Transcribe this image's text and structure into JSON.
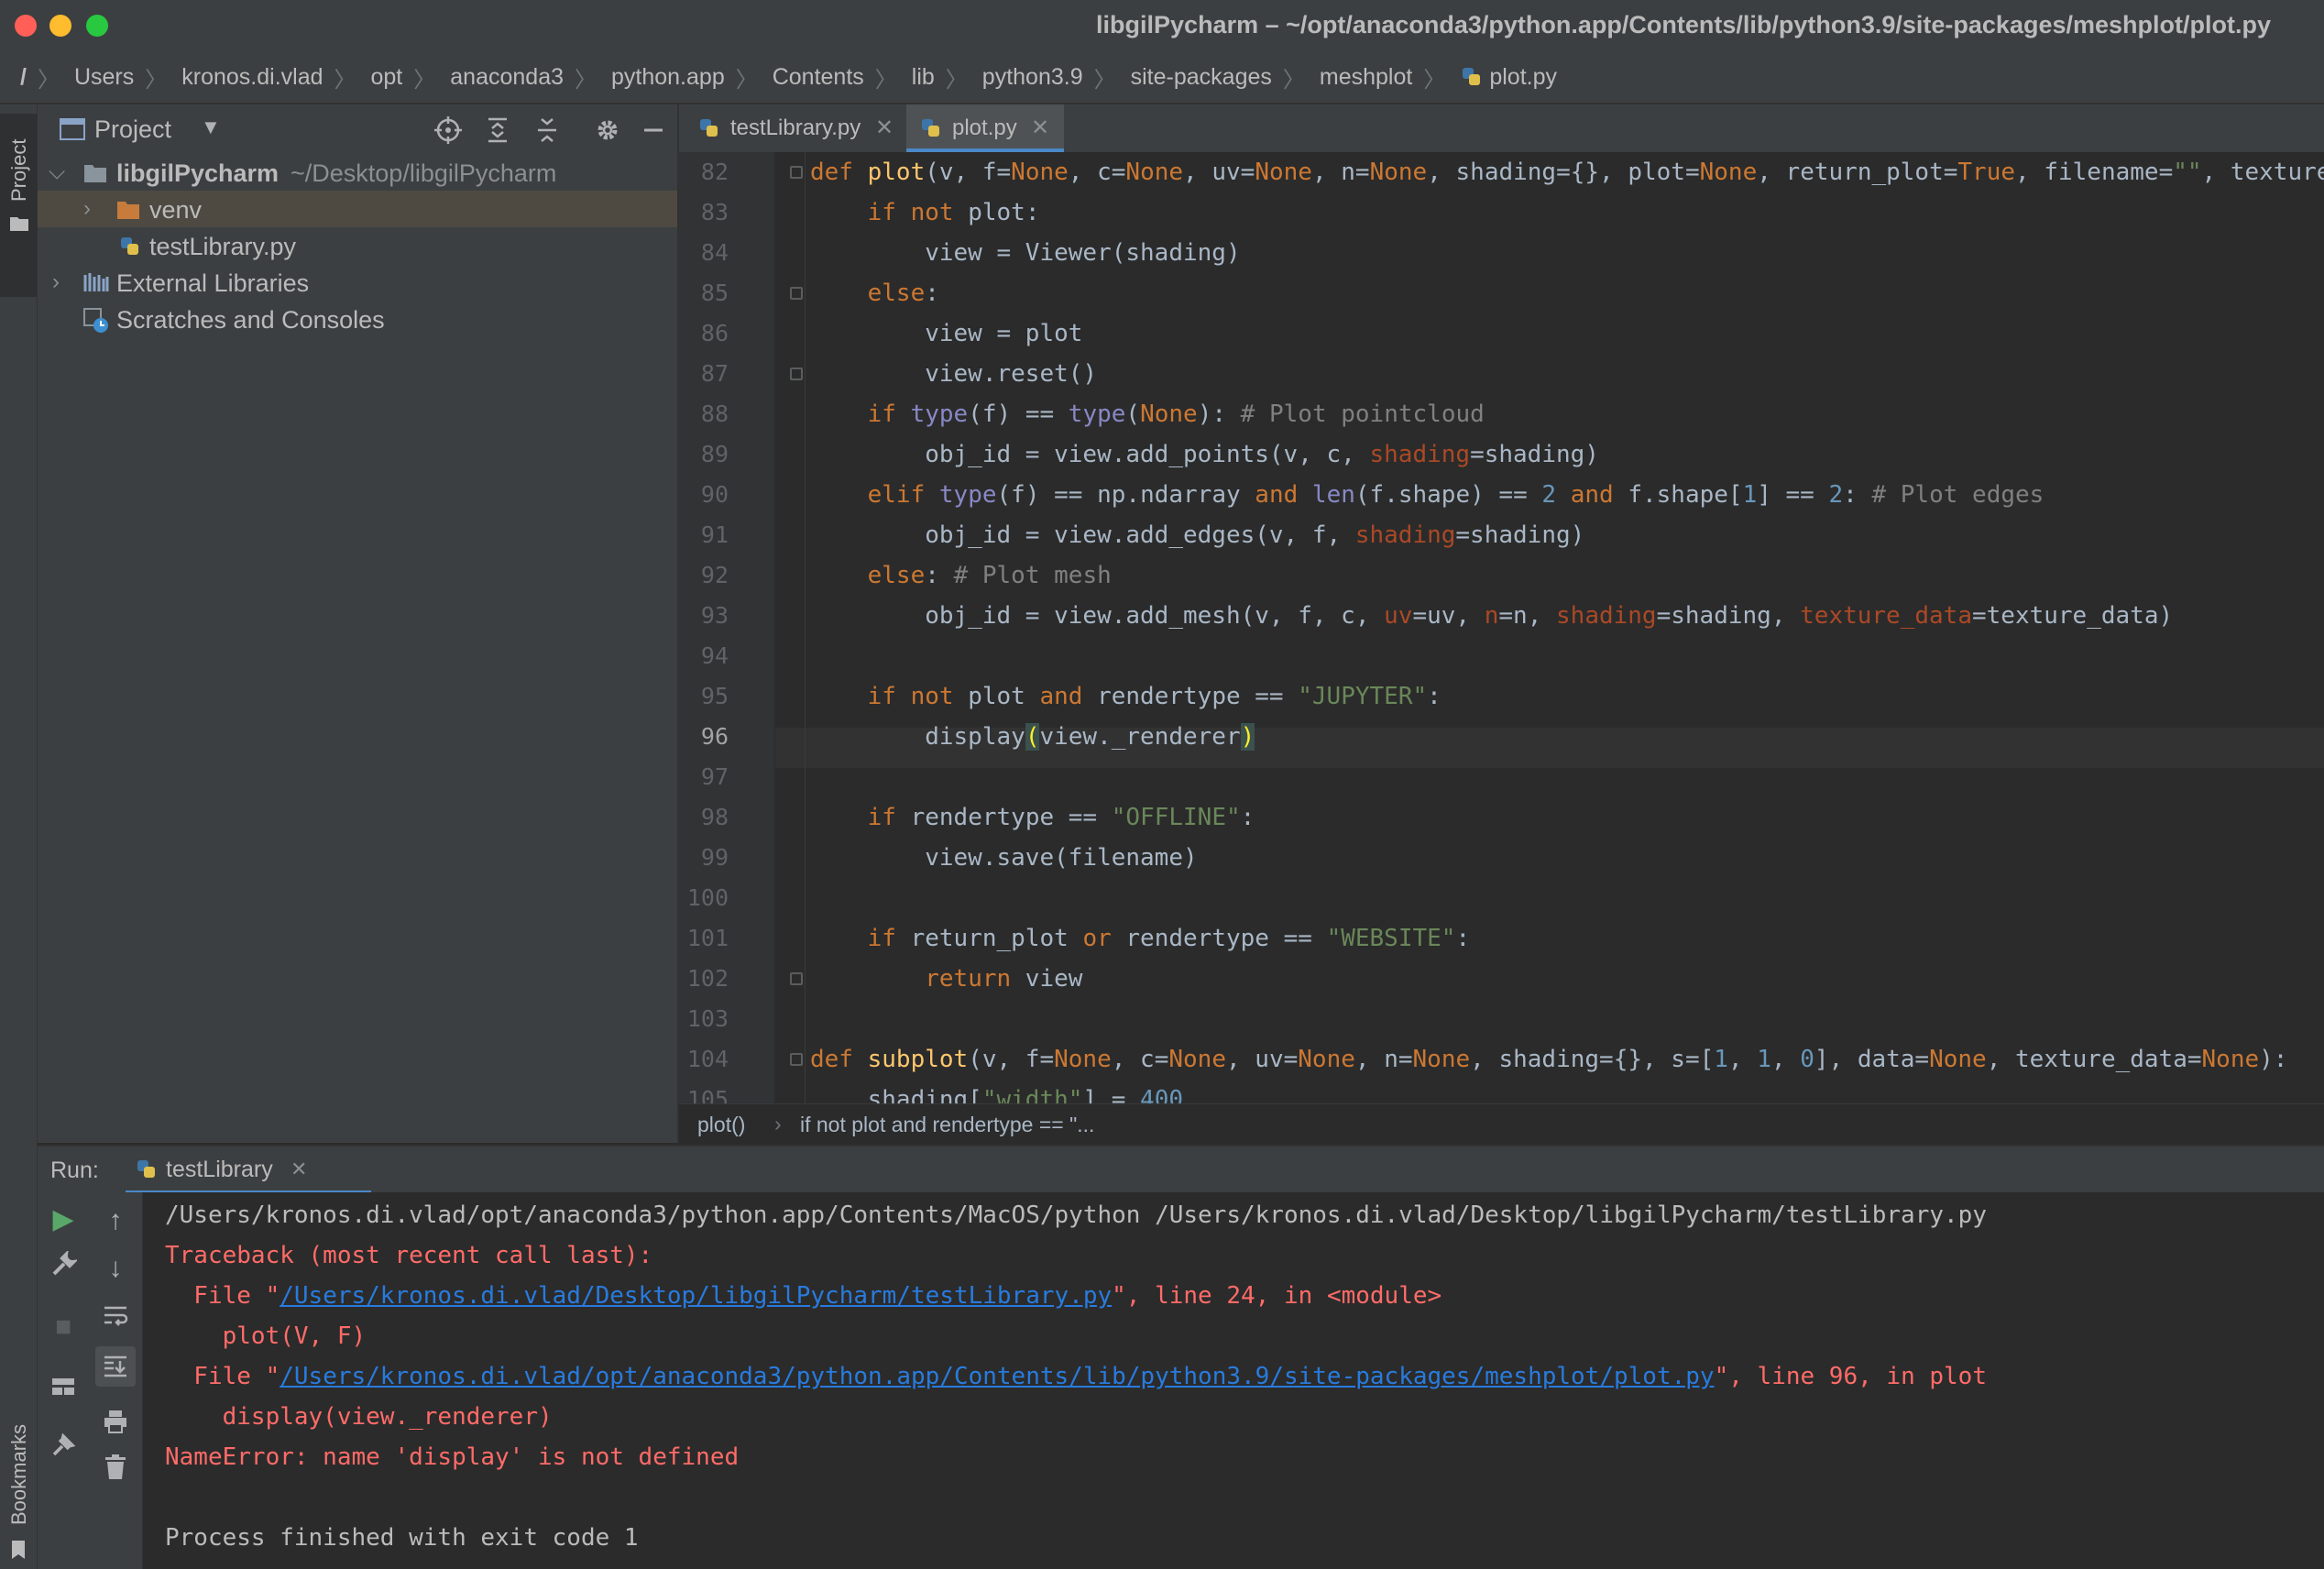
{
  "window": {
    "title": "libgilPycharm – ~/opt/anaconda3/python.app/Contents/lib/python3.9/site-packages/meshplot/plot.py"
  },
  "breadcrumbs": [
    "/",
    "Users",
    "kronos.di.vlad",
    "opt",
    "anaconda3",
    "python.app",
    "Contents",
    "lib",
    "python3.9",
    "site-packages",
    "meshplot",
    "plot.py"
  ],
  "sidebar": {
    "stripe_label": "Project",
    "bookmarks_label": "Bookmarks"
  },
  "project_panel": {
    "title": "Project",
    "tree": [
      {
        "label": "libgilPycharm",
        "hint": "~/Desktop/libgilPycharm",
        "expanded": true
      },
      {
        "label": "venv",
        "expanded": false
      },
      {
        "label": "testLibrary.py"
      },
      {
        "label": "External Libraries",
        "expanded": false
      },
      {
        "label": "Scratches and Consoles"
      }
    ]
  },
  "editor_tabs": [
    {
      "label": "testLibrary.py",
      "active": false
    },
    {
      "label": "plot.py",
      "active": true
    }
  ],
  "editor": {
    "current_line": 96,
    "line_numbers": [
      "82",
      "83",
      "84",
      "85",
      "86",
      "87",
      "88",
      "89",
      "90",
      "91",
      "92",
      "93",
      "94",
      "95",
      "96",
      "97",
      "98",
      "99",
      "100",
      "101",
      "102",
      "103",
      "104",
      "105"
    ]
  },
  "editor_breadcrumb": {
    "func": "plot()",
    "stmt": "if not plot and rendertype == \"..."
  },
  "run_panel": {
    "label": "Run:",
    "tab": "testLibrary",
    "console": {
      "cmd": "/Users/kronos.di.vlad/opt/anaconda3/python.app/Contents/MacOS/python /Users/kronos.di.vlad/Desktop/libgilPycharm/testLibrary.py",
      "traceback": "Traceback (most recent call last):",
      "file1_prefix": "  File \"",
      "file1_path": "/Users/kronos.di.vlad/Desktop/libgilPycharm/testLibrary.py",
      "file1_suffix": "\", line 24, in <module>",
      "code1": "    plot(V, F)",
      "file2_prefix": "  File \"",
      "file2_path": "/Users/kronos.di.vlad/opt/anaconda3/python.app/Contents/lib/python3.9/site-packages/meshplot/plot.py",
      "file2_suffix": "\", line 96, in plot",
      "code2": "    display(view._renderer)",
      "error": "NameError: name 'display' is not defined",
      "exit": "Process finished with exit code 1"
    }
  },
  "colors": {
    "keyword": "#cc7832",
    "function": "#ffc66d",
    "string": "#6a8759",
    "number": "#6897bb",
    "comment": "#808080",
    "error": "#ff6b68",
    "link": "#287bde"
  }
}
